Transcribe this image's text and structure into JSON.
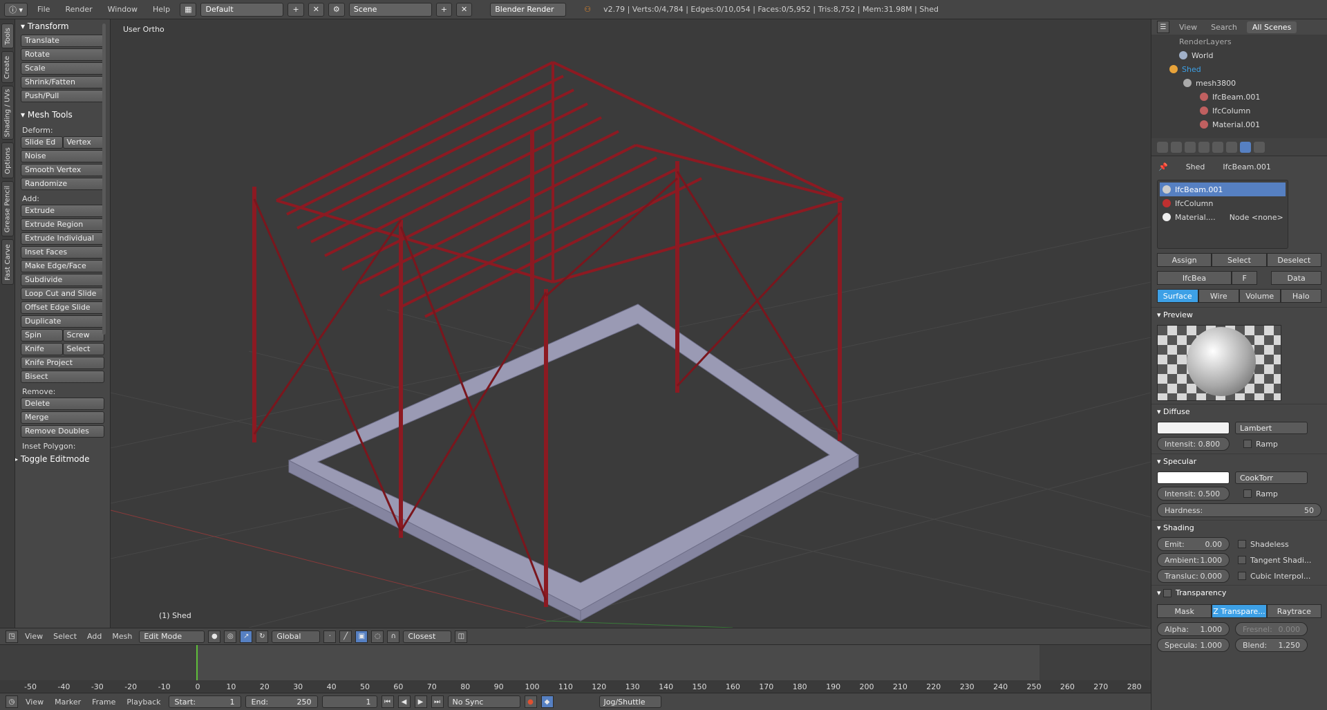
{
  "topbar": {
    "menus": [
      "File",
      "Render",
      "Window",
      "Help"
    ],
    "layout": "Default",
    "scene": "Scene",
    "engine": "Blender Render",
    "stats": "v2.79 | Verts:0/4,784 | Edges:0/10,054 | Faces:0/5,952 | Tris:8,752 | Mem:31.98M | Shed"
  },
  "left_tabs": [
    "Tools",
    "Create",
    "Shading / UVs",
    "Options",
    "Grease Pencil",
    "Fast Carve"
  ],
  "toolshelf": {
    "transform_title": "Transform",
    "transform": [
      "Translate",
      "Rotate",
      "Scale",
      "Shrink/Fatten",
      "Push/Pull"
    ],
    "mesh_title": "Mesh Tools",
    "deform_label": "Deform:",
    "slide_edge": "Slide Ed",
    "vertex": "Vertex",
    "deform": [
      "Noise",
      "Smooth Vertex",
      "Randomize"
    ],
    "add_label": "Add:",
    "extrude": "Extrude",
    "add": [
      "Extrude Region",
      "Extrude Individual",
      "Inset Faces",
      "Make Edge/Face",
      "Subdivide",
      "Loop Cut and Slide",
      "Offset Edge Slide",
      "Duplicate"
    ],
    "spin": "Spin",
    "screw": "Screw",
    "knife": "Knife",
    "select": "Select",
    "add2": [
      "Knife Project",
      "Bisect"
    ],
    "remove_label": "Remove:",
    "delete": "Delete",
    "merge": "Merge",
    "remove_doubles": "Remove Doubles",
    "inset_polygon": "Inset Polygon:",
    "toggle_editmode": "Toggle Editmode"
  },
  "viewport": {
    "view_name": "User Ortho",
    "object_label": "(1) Shed"
  },
  "vp_header": {
    "menus": [
      "View",
      "Select",
      "Add",
      "Mesh"
    ],
    "mode": "Edit Mode",
    "orientation": "Global",
    "snap": "Closest"
  },
  "timeline": {
    "ticks": [
      "-50",
      "-40",
      "-30",
      "-20",
      "-10",
      "0",
      "10",
      "20",
      "30",
      "40",
      "50",
      "60",
      "70",
      "80",
      "90",
      "100",
      "110",
      "120",
      "130",
      "140",
      "150",
      "160",
      "170",
      "180",
      "190",
      "200",
      "210",
      "220",
      "230",
      "240",
      "250",
      "260",
      "270",
      "280"
    ],
    "menus": [
      "View",
      "Marker",
      "Frame",
      "Playback"
    ],
    "start_label": "Start:",
    "start": "1",
    "end_label": "End:",
    "end": "250",
    "current": "1",
    "sync": "No Sync",
    "keying": "Jog/Shuttle"
  },
  "outliner": {
    "tabs": [
      "View",
      "Search",
      "All Scenes"
    ],
    "rows": [
      "RenderLayers",
      "World",
      "Shed",
      "mesh3800",
      "IfcBeam.001",
      "IfcColumn",
      "Material.001"
    ]
  },
  "properties": {
    "breadcrumb_object": "Shed",
    "breadcrumb_material": "IfcBeam.001",
    "materials": [
      "IfcBeam.001",
      "IfcColumn",
      "Material...."
    ],
    "material_node": "Node <none>",
    "assign": "Assign",
    "select": "Select",
    "deselect": "Deselect",
    "mat_name": "IfcBea",
    "fake_user": "F",
    "data": "Data",
    "type_tabs": [
      "Surface",
      "Wire",
      "Volume",
      "Halo"
    ],
    "preview_title": "Preview",
    "diffuse_title": "Diffuse",
    "diffuse_shader": "Lambert",
    "diffuse_intensity": "Intensit:  0.800",
    "ramp": "Ramp",
    "specular_title": "Specular",
    "specular_shader": "CookTorr",
    "specular_intensity": "Intensit:  0.500",
    "hardness_label": "Hardness:",
    "hardness": "50",
    "shading_title": "Shading",
    "emit_label": "Emit:",
    "emit": "0.00",
    "ambient_label": "Ambient:",
    "ambient": "1.000",
    "transluc_label": "Transluc:",
    "transluc": "0.000",
    "shadeless": "Shadeless",
    "tangent": "Tangent Shadi...",
    "cubic": "Cubic Interpol...",
    "transparency_title": "Transparency",
    "trans_tabs": [
      "Mask",
      "Z Transpare...",
      "Raytrace"
    ],
    "alpha_label": "Alpha:",
    "alpha": "1.000",
    "fresnel_label": "Fresnel:",
    "fresnel": "0.000",
    "specula_label": "Specula:",
    "specula": "1.000",
    "blend_label": "Blend:",
    "blend": "1.250"
  },
  "colors": {
    "accent": "#5680c2",
    "selected": "#3da0e6",
    "steel": "#8c1a22",
    "concrete": "#9a9ab4"
  }
}
